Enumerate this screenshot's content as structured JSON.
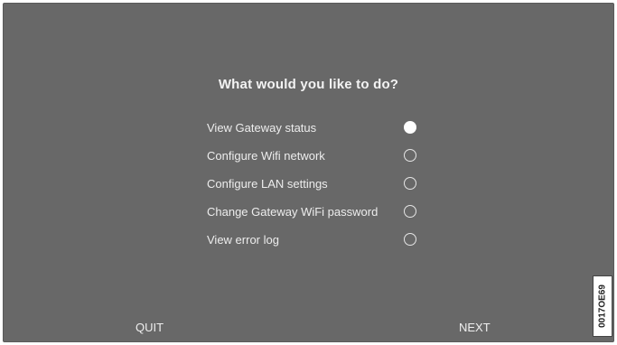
{
  "prompt": {
    "title": "What would you like to do?"
  },
  "options": [
    {
      "label": "View Gateway status",
      "selected": true
    },
    {
      "label": "Configure Wifi network",
      "selected": false
    },
    {
      "label": "Configure LAN settings",
      "selected": false
    },
    {
      "label": "Change Gateway WiFi password",
      "selected": false
    },
    {
      "label": "View error log",
      "selected": false
    }
  ],
  "footer": {
    "quit_label": "QUIT",
    "next_label": "NEXT"
  },
  "figure_code": "0017OE69",
  "colors": {
    "background": "#686868",
    "text": "#ededed",
    "radio_selected": "#ffffff"
  }
}
